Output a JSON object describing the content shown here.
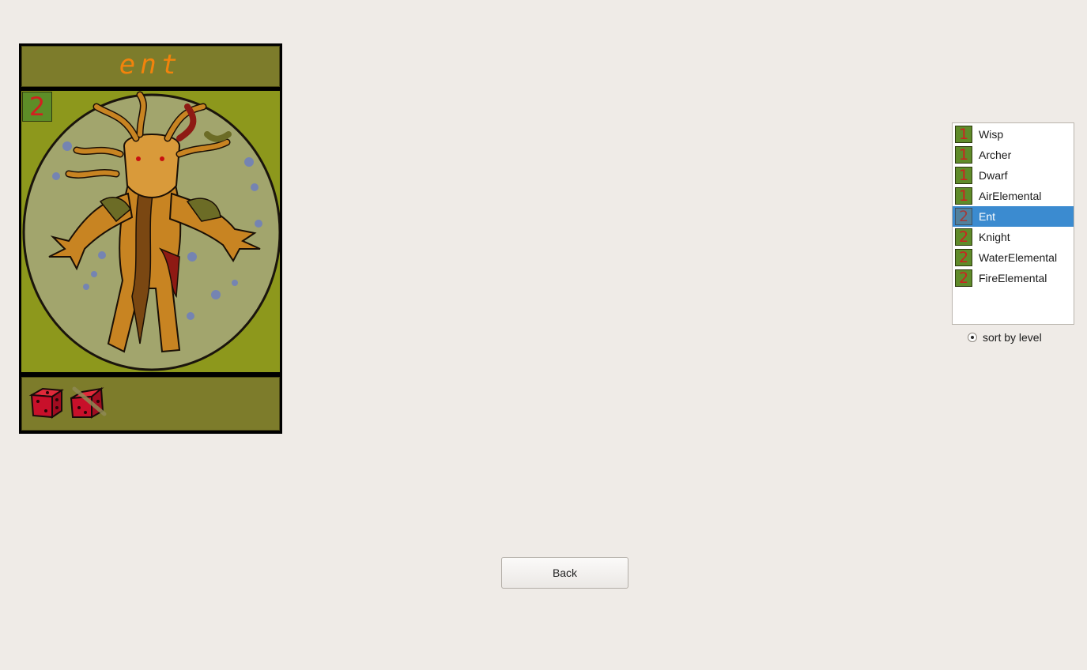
{
  "card": {
    "name": "ent",
    "level": "2",
    "art_icon": "ent-tree-creature",
    "dice": [
      "die-icon",
      "die-crossed-icon"
    ],
    "colors": {
      "frame": "#000000",
      "bar": "#7d7c2b",
      "art_background": "#8d981c",
      "title": "#f2830c",
      "level": "#d31f1f"
    }
  },
  "unit_list": {
    "items": [
      {
        "level": "1",
        "label": "Wisp",
        "selected": false
      },
      {
        "level": "1",
        "label": "Archer",
        "selected": false
      },
      {
        "level": "1",
        "label": "Dwarf",
        "selected": false
      },
      {
        "level": "1",
        "label": "AirElemental",
        "selected": false
      },
      {
        "level": "2",
        "label": "Ent",
        "selected": true
      },
      {
        "level": "2",
        "label": "Knight",
        "selected": false
      },
      {
        "level": "2",
        "label": "WaterElemental",
        "selected": false
      },
      {
        "level": "2",
        "label": "FireElemental",
        "selected": false
      }
    ],
    "selection_color": "#3b8bd0"
  },
  "sort_option": {
    "label": "sort by level",
    "checked": true
  },
  "back_button": {
    "label": "Back"
  }
}
